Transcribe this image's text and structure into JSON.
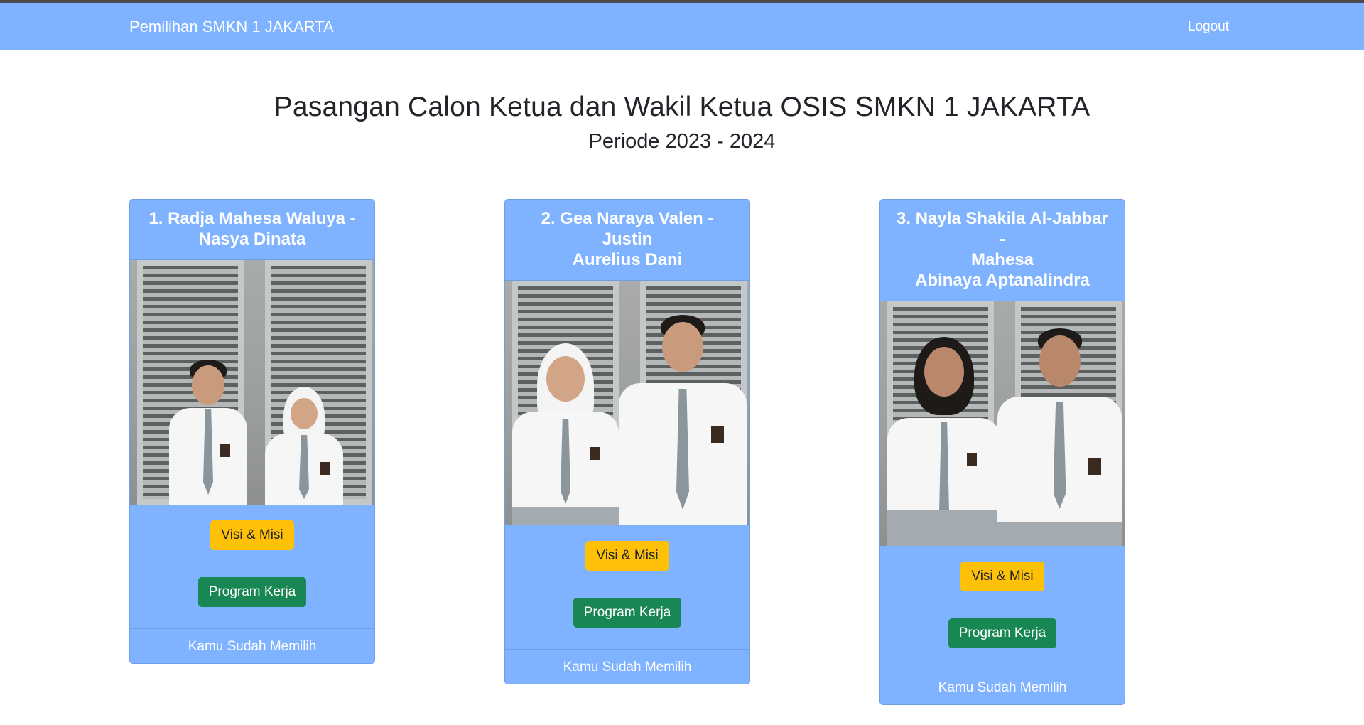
{
  "navbar": {
    "brand": "Pemilihan SMKN 1 JAKARTA",
    "logout": "Logout"
  },
  "heading": {
    "title": "Pasangan Calon Ketua dan Wakil Ketua OSIS SMKN 1 JAKARTA",
    "subtitle": "Periode 2023 - 2024"
  },
  "candidates": [
    {
      "header_line1": "1. Radja Mahesa Waluya -",
      "header_line2": "Nasya Dinata",
      "header_line3": "",
      "visi_label": "Visi & Misi",
      "program_label": "Program Kerja",
      "footer": "Kamu Sudah Memilih"
    },
    {
      "header_line1": "2. Gea Naraya Valen - Justin",
      "header_line2": "Aurelius Dani",
      "header_line3": "",
      "visi_label": "Visi & Misi",
      "program_label": "Program Kerja",
      "footer": "Kamu Sudah Memilih"
    },
    {
      "header_line1": "3. Nayla Shakila Al-Jabbar -",
      "header_line2": "Mahesa",
      "header_line3": "Abinaya Aptanalindra",
      "visi_label": "Visi & Misi",
      "program_label": "Program Kerja",
      "footer": "Kamu Sudah Memilih"
    }
  ],
  "colors": {
    "navbar": "#80b3ff",
    "card": "#80b3ff",
    "visi_button": "#ffc107",
    "program_button": "#198754"
  }
}
